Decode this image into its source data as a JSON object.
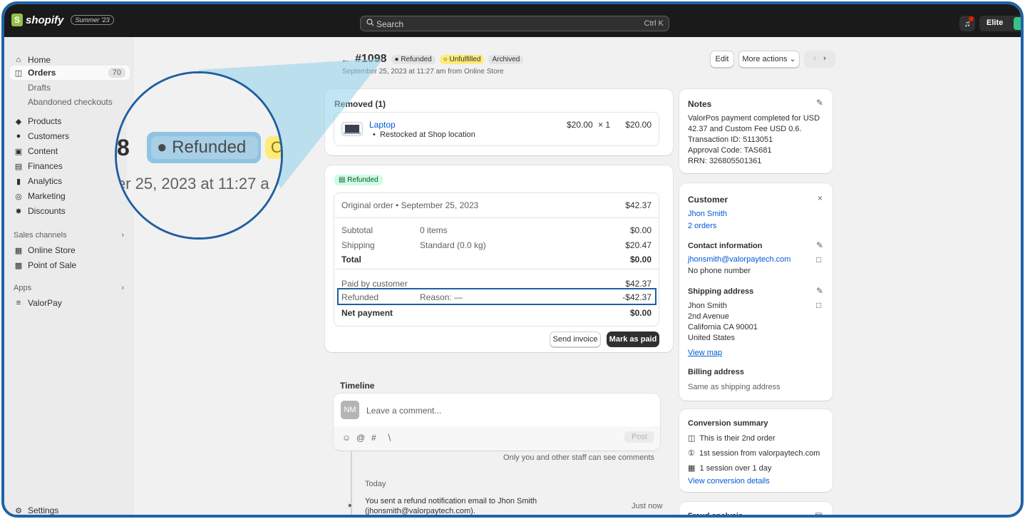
{
  "topbar": {
    "logo_text": "shopify",
    "edition_badge": "Summer '23",
    "search_placeholder": "Search",
    "search_shortcut": "Ctrl K",
    "store_name": "Elite"
  },
  "sidebar": {
    "items": [
      {
        "label": "Home",
        "icon": "home-icon"
      },
      {
        "label": "Orders",
        "icon": "orders-icon",
        "count": "70",
        "active": true
      },
      {
        "label": "Drafts",
        "sub": true
      },
      {
        "label": "Abandoned checkouts",
        "sub": true
      },
      {
        "label": "Products",
        "icon": "tag-icon"
      },
      {
        "label": "Customers",
        "icon": "person-icon"
      },
      {
        "label": "Content",
        "icon": "content-icon"
      },
      {
        "label": "Finances",
        "icon": "bank-icon"
      },
      {
        "label": "Analytics",
        "icon": "bar-chart-icon"
      },
      {
        "label": "Marketing",
        "icon": "target-icon"
      },
      {
        "label": "Discounts",
        "icon": "discount-icon"
      }
    ],
    "sales_channels_label": "Sales channels",
    "channels": [
      {
        "label": "Online Store",
        "icon": "store-icon"
      },
      {
        "label": "Point of Sale",
        "icon": "pos-icon"
      }
    ],
    "apps_label": "Apps",
    "apps": [
      {
        "label": "ValorPay",
        "icon": "app-icon"
      }
    ],
    "settings_label": "Settings"
  },
  "magnifier": {
    "order_digit": "8",
    "status": "Refunded",
    "next_badge": "O",
    "date_fragment": "er 25, 2023 at 11:27 a"
  },
  "order": {
    "back_arrow": "←",
    "number": "#1098",
    "badges": {
      "refunded": "Refunded",
      "unfulfilled": "Unfulfilled",
      "archived": "Archived"
    },
    "subtitle": "September 25, 2023 at 11:27 am from Online Store",
    "actions": {
      "edit": "Edit",
      "more": "More actions",
      "prev": "‹",
      "next": "›"
    }
  },
  "removed": {
    "title": "Removed (1)",
    "item_name": "Laptop",
    "item_note": "Restocked at Shop location",
    "unit_price": "$20.00",
    "qty": "× 1",
    "total": "$20.00"
  },
  "payment": {
    "status": "Refunded",
    "original_order_label": "Original order • September 25, 2023",
    "original_order_amount": "$42.37",
    "rows": [
      {
        "label": "Subtotal",
        "detail": "0 items",
        "amount": "$0.00"
      },
      {
        "label": "Shipping",
        "detail": "Standard (0.0 kg)",
        "amount": "$20.47"
      },
      {
        "label": "Total",
        "detail": "",
        "amount": "$0.00"
      }
    ],
    "paid_label": "Paid by customer",
    "paid_amount": "$42.37",
    "refunded_label": "Refunded",
    "refunded_reason": "Reason: —",
    "refunded_amount": "-$42.37",
    "net_label": "Net payment",
    "net_amount": "$0.00",
    "send_invoice": "Send invoice",
    "mark_as_paid": "Mark as paid"
  },
  "timeline": {
    "title": "Timeline",
    "avatar": "NM",
    "comment_placeholder": "Leave a comment...",
    "post_label": "Post",
    "staff_note": "Only you and other staff can see comments",
    "today_label": "Today",
    "event_line1": "You sent a refund notification email to Jhon Smith",
    "event_line2": "(jhonsmith@valorpaytech.com).",
    "event_time": "Just now"
  },
  "notes": {
    "title": "Notes",
    "lines": [
      "ValorPos payment completed for USD",
      "42.37 and Custom Fee USD 0.6.",
      "Transaction ID: 5113051",
      "Approval Code: TAS681",
      "RRN: 326805501361"
    ]
  },
  "customer": {
    "title": "Customer",
    "name": "Jhon Smith",
    "orders": "2 orders",
    "contact_title": "Contact information",
    "email": "jhonsmith@valorpaytech.com",
    "phone": "No phone number",
    "shipping_title": "Shipping address",
    "address_lines": [
      "Jhon Smith",
      "2nd Avenue",
      "California CA 90001",
      "United States"
    ],
    "view_map": "View map",
    "billing_title": "Billing address",
    "billing_value": "Same as shipping address"
  },
  "conversion": {
    "title": "Conversion summary",
    "lines": [
      "This is their 2nd order",
      "1st session from valorpaytech.com",
      "1 session over 1 day"
    ],
    "details_link": "View conversion details"
  },
  "fraud": {
    "title": "Fraud analysis"
  },
  "colors": {
    "accent_link": "#005bd3",
    "refunded_badge": "#e3e3e3",
    "unfulfilled_badge": "#ffeb78",
    "paid_badge": "#cdfee1",
    "highlight_border": "#1f5fa0"
  }
}
